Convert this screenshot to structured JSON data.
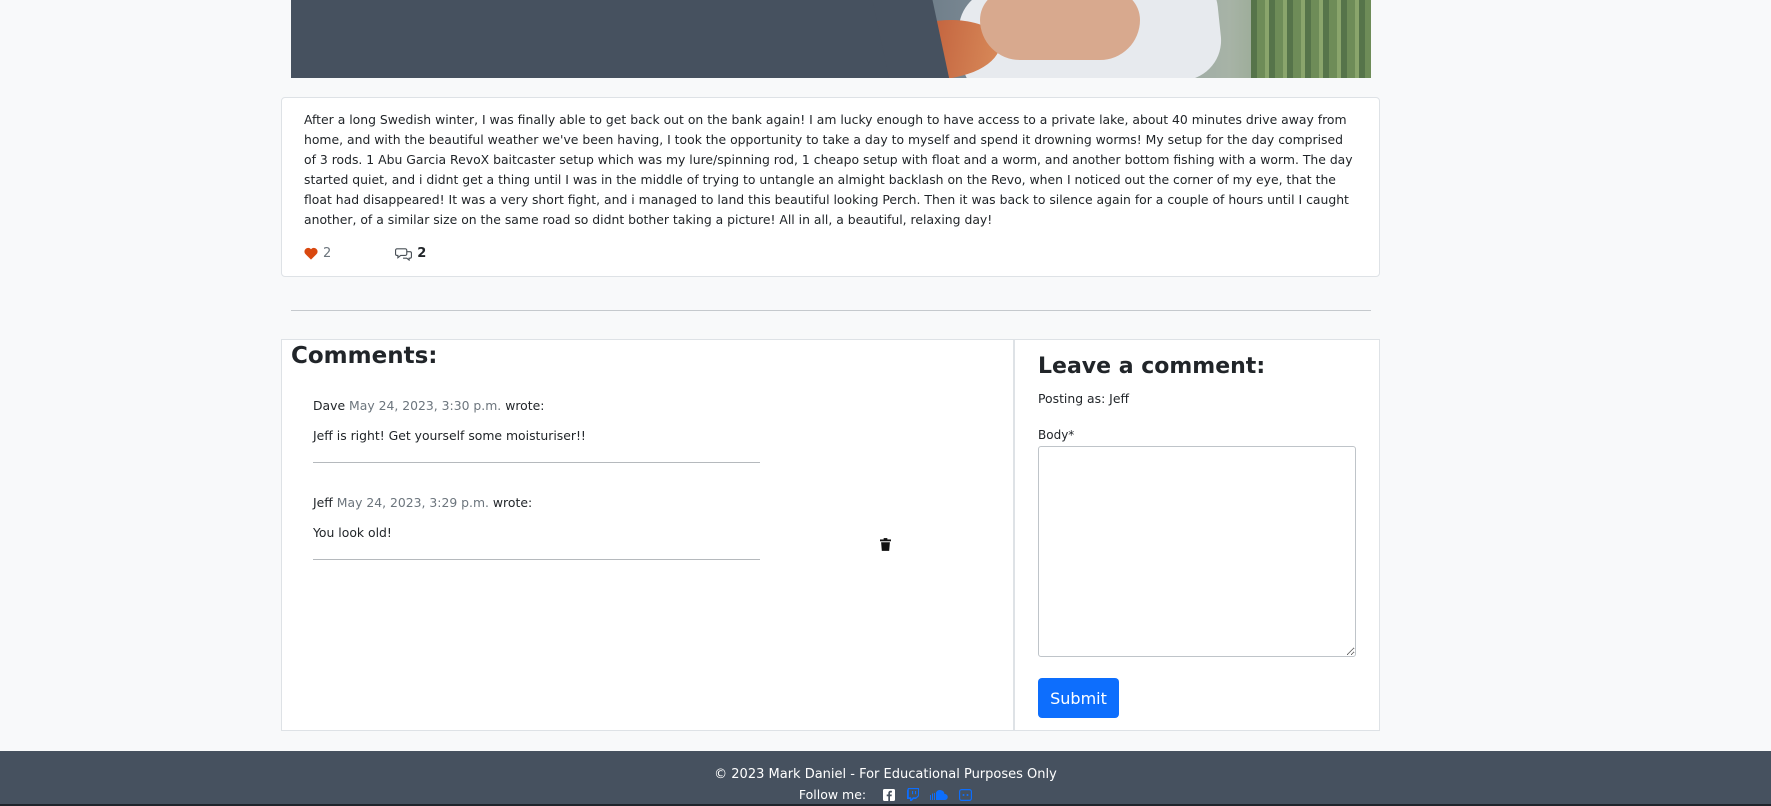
{
  "post": {
    "body": "After a long Swedish winter, I was finally able to get back out on the bank again! I am lucky enough to have access to a private lake, about 40 minutes drive away from home, and with the beautiful weather we've been having, I took the opportunity to take a day to myself and spend it drowning worms! My setup for the day comprised of 3 rods. 1 Abu Garcia RevoX baitcaster setup which was my lure/spinning rod, 1 cheapo setup with float and a worm, and another bottom fishing with a worm. The day started quiet, and i didnt get a thing until I was in the middle of trying to untangle an almight backlash on the Revo, when I noticed out the corner of my eye, that the float had disappeared! It was a very short fight, and i managed to land this beautiful looking Perch. Then it was back to silence again for a couple of hours until I caught another, of a similar size on the same road so didnt bother taking a picture! All in all, a beautiful, relaxing day!",
    "likes": "2",
    "comment_count": "2",
    "like_icon": "heart-icon",
    "comment_icon": "chat-bubbles-icon"
  },
  "comments": {
    "title": "Comments:",
    "items": [
      {
        "author": "Dave",
        "date": "May 24, 2023, 3:30 p.m.",
        "wrote": "wrote:",
        "text": "Jeff is right! Get yourself some moisturiser!!"
      },
      {
        "author": "Jeff",
        "date": "May 24, 2023, 3:29 p.m.",
        "wrote": "wrote:",
        "text": "You look old!"
      }
    ],
    "delete_icon": "trash-icon"
  },
  "form": {
    "title": "Leave a comment:",
    "posting_as": "Posting as: Jeff",
    "body_label": "Body*",
    "submit_label": "Submit"
  },
  "footer": {
    "copyright": "© 2023 Mark Daniel - For Educational Purposes Only",
    "follow": "Follow me:",
    "social_icons": [
      "facebook-icon",
      "twitch-icon",
      "soundcloud-icon",
      "discord-icon"
    ]
  },
  "colors": {
    "accent": "#0d6efd",
    "like_heart": "#d9480f",
    "footer_bg": "#46515f",
    "date_text": "#6c757d"
  }
}
